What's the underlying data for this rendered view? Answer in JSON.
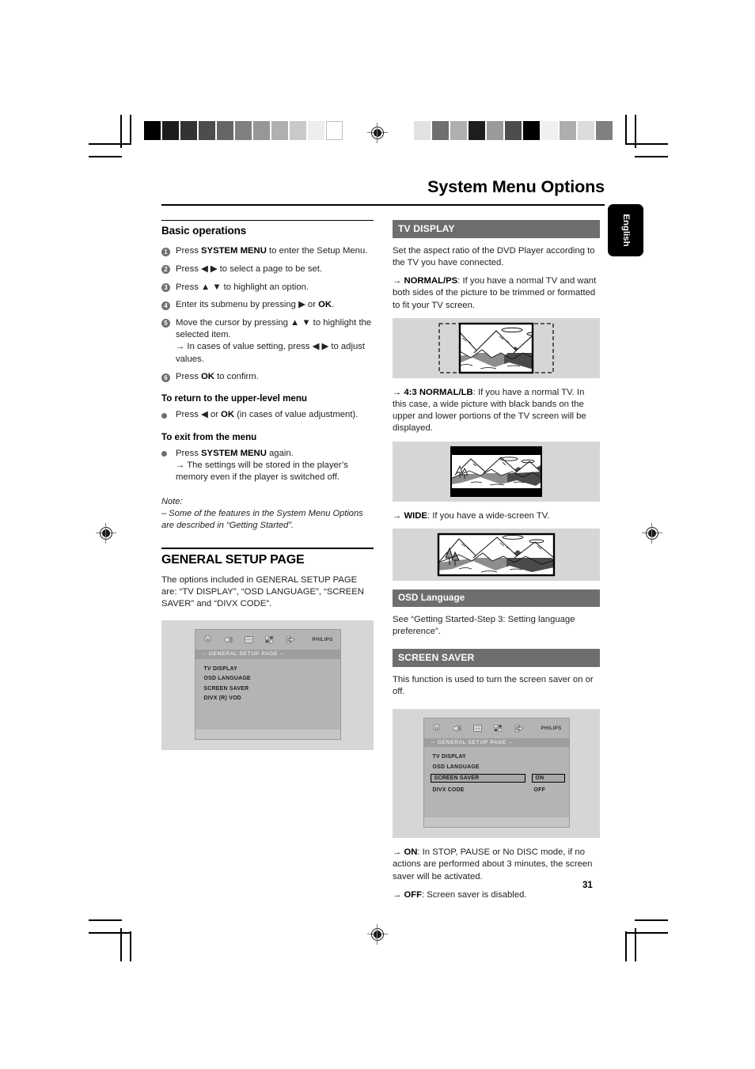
{
  "document": {
    "title": "System Menu Options",
    "page_number": "31",
    "language_tab": "English"
  },
  "left_column": {
    "section_heading": "Basic operations",
    "steps": [
      {
        "num": "1",
        "html": "Press <b>SYSTEM MENU</b> to enter the Setup Menu."
      },
      {
        "num": "2",
        "html": "Press ◀ ▶ to select a page to be set."
      },
      {
        "num": "3",
        "html": "Press ▲ ▼  to highlight an option."
      },
      {
        "num": "4",
        "html": "Enter its submenu by pressing ▶ or <b>OK</b>."
      },
      {
        "num": "5",
        "html": "Move the cursor by pressing ▲ ▼ to highlight the selected item.<br><span class=\"arrow\">→</span> In cases of value setting, press ◀ ▶ to adjust values."
      },
      {
        "num": "6",
        "html": "Press <b>OK</b> to confirm."
      }
    ],
    "return_heading": "To return to the upper-level menu",
    "return_bullet": "Press ◀ or <b>OK</b> (in cases of value adjustment).",
    "exit_heading": "To exit from the menu",
    "exit_bullet": "Press <b>SYSTEM MENU</b> again.<br><span class=\"arrow\">→</span> The settings will be stored in the player’s memory even if the player is switched off.",
    "note_label": "Note:",
    "note_body": "–   Some of the features in the System Menu Options are described in “Getting Started”.",
    "general_setup_heading": "GENERAL SETUP PAGE",
    "general_setup_body": "The options included in GENERAL SETUP PAGE are: “TV DISPLAY”, “OSD LANGUAGE”, “SCREEN SAVER” and  “DIVX CODE”."
  },
  "right_column": {
    "tv_display": {
      "bar_label": "TV DISPLAY",
      "intro": "Set the aspect ratio of the DVD Player according to the TV you have connected.",
      "normal_ps": "<span class=\"arrow\">→</span> <b>NORMAL/PS</b>: If you have a normal TV and want both sides of the picture to be trimmed or formatted to fit your TV screen.",
      "normal_lb": "<span class=\"arrow\">→</span> <b>4:3 NORMAL/LB</b>: If you have a normal TV. In this case, a wide picture with black bands on the upper and lower portions of the TV screen will be displayed.",
      "wide": "<span class=\"arrow\">→</span> <b>WIDE</b>: If you have a wide-screen TV."
    },
    "osd_language": {
      "bar_label": "OSD Language",
      "body": "See “Getting Started-Step 3: Setting language preference”."
    },
    "screen_saver": {
      "bar_label": "SCREEN SAVER",
      "body": "This function is used to turn the screen saver on or off.",
      "on": "<span class=\"arrow\">→</span> <b>ON</b>: In STOP, PAUSE or No DISC mode, if no actions are performed about 3 minutes, the screen saver will be activated.",
      "off": "<span class=\"arrow\">→</span> <b>OFF</b>: Screen saver is disabled."
    }
  },
  "osd_menu_1": {
    "page_label": "-- GENERAL  SETUP  PAGE --",
    "brand": "PHILIPS",
    "items": [
      "TV DISPLAY",
      "OSD LANGUAGE",
      "SCREEN SAVER",
      "DIVX (R) VOD"
    ]
  },
  "osd_menu_2": {
    "page_label": "-- GENERAL  SETUP  PAGE --",
    "brand": "PHILIPS",
    "items": [
      "TV DISPLAY",
      "OSD LANGUAGE",
      "SCREEN SAVER",
      "DIVX CODE"
    ],
    "selected_item": "SCREEN SAVER",
    "value_selected": "ON",
    "value_other": "OFF"
  },
  "print_marks": {
    "grayscale_bar": [
      "#000000",
      "#1c1c1c",
      "#333333",
      "#4d4d4d",
      "#666666",
      "#808080",
      "#979797",
      "#b0b0b0",
      "#c9c9c9",
      "#eeeeee",
      "#ffffff"
    ],
    "color_bar": [
      "#e2e2e2",
      "#6f6f6f",
      "#b0b0b0",
      "#1e1e1e",
      "#9a9a9a",
      "#4d4d4d",
      "#000000",
      "#f0f0f0",
      "#aeaeae",
      "#dcdcdc",
      "#808080"
    ]
  }
}
